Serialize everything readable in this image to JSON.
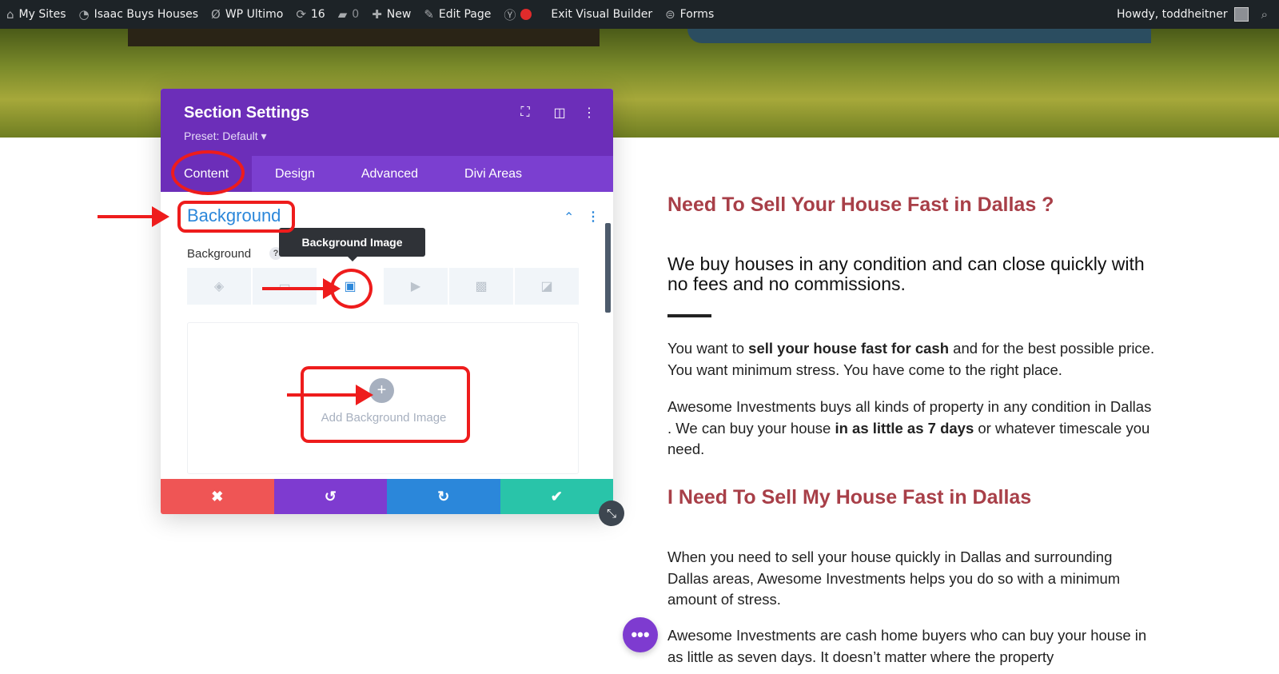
{
  "adminbar": {
    "my_sites": "My Sites",
    "site_name": "Isaac Buys Houses",
    "wp_ultimo": "WP Ultimo",
    "updates": "16",
    "comments": "0",
    "new": "New",
    "edit_page": "Edit Page",
    "exit_builder": "Exit Visual Builder",
    "forms": "Forms",
    "howdy": "Howdy, toddheitner"
  },
  "modal": {
    "title": "Section Settings",
    "preset": "Preset: Default ▾",
    "tabs": [
      "Content",
      "Design",
      "Advanced",
      "Divi Areas"
    ],
    "section_heading": "Background",
    "field_label": "Background",
    "help": "?",
    "tooltip": "Background Image",
    "add_image": "Add Background Image",
    "plus": "+",
    "icons": {
      "fullscreen": "⛶",
      "split": "◫",
      "more": "⋮",
      "chevron": "⌃",
      "dots": "⋮",
      "bgtabs": [
        "◈",
        "▭",
        "▣",
        "▶",
        "▩",
        "◪"
      ],
      "cancel": "✖",
      "undo": "↺",
      "redo": "↻",
      "save": "✔",
      "resize": "⤡"
    }
  },
  "content": {
    "heading1": "Need To Sell Your House Fast in Dallas ?",
    "lead": "We buy houses in any condition and can close quickly with no fees and no commissions.",
    "p1": [
      "You want to ",
      "sell your house fast for cash",
      " and for the best possible price. You want minimum stress. You have come to the right place."
    ],
    "p2": [
      "Awesome Investments buys all kinds of property in any condition in Dallas . We can buy your house ",
      "in as little as 7 days",
      " or whatever timescale you need."
    ],
    "heading2": "I Need To Sell My House Fast in Dallas",
    "p3": "When you need to sell your house quickly in Dallas and surrounding Dallas areas, Awesome Investments helps you do so with a minimum amount of stress.",
    "p4": "Awesome Investments are cash home buyers who can buy your house in as little as seven days. It doesn’t matter where the property",
    "fab": "•••"
  }
}
